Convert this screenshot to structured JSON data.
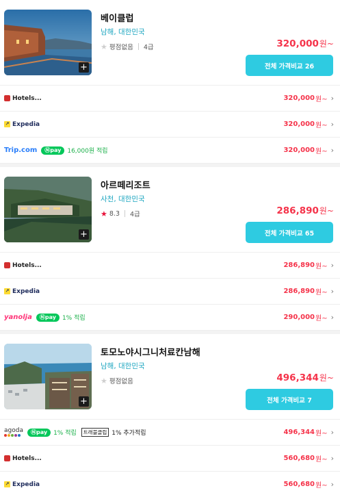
{
  "hotels": [
    {
      "name": "베이클럽",
      "location": "남해, 대한민국",
      "rating_text": "평점없음",
      "grade": "4급",
      "price": "320,000",
      "price_unit": "원~",
      "compare_label": "전체 가격비교 26",
      "offers": [
        {
          "site": "Hotels...",
          "promo": "",
          "extra_badge": "",
          "extra_text": "",
          "price": "320,000",
          "unit": "원~"
        },
        {
          "site": "Expedia",
          "promo": "",
          "extra_badge": "",
          "extra_text": "",
          "price": "320,000",
          "unit": "원~"
        },
        {
          "site": "Trip.com",
          "npay": "pay",
          "promo": "16,000원 적립",
          "extra_badge": "",
          "extra_text": "",
          "price": "320,000",
          "unit": "원~"
        }
      ]
    },
    {
      "name": "아르떼리조트",
      "location": "사천, 대한민국",
      "rating_text": "8.3",
      "grade": "4급",
      "price": "286,890",
      "price_unit": "원~",
      "compare_label": "전체 가격비교 65",
      "offers": [
        {
          "site": "Hotels...",
          "price": "286,890",
          "unit": "원~"
        },
        {
          "site": "Expedia",
          "price": "286,890",
          "unit": "원~"
        },
        {
          "site": "yanolja",
          "npay": "pay",
          "promo": "1% 적립",
          "price": "290,000",
          "unit": "원~"
        }
      ]
    },
    {
      "name": "토모노야시그니처료칸남해",
      "location": "남해, 대한민국",
      "rating_text": "평점없음",
      "grade": "",
      "price": "496,344",
      "price_unit": "원~",
      "compare_label": "전체 가격비교 7",
      "offers": [
        {
          "site": "agoda",
          "npay": "pay",
          "promo": "1% 적립",
          "extra_badge": "트래블클럽",
          "extra_text": "1% 추가적립",
          "price": "496,344",
          "unit": "원~"
        },
        {
          "site": "Hotels...",
          "price": "560,680",
          "unit": "원~"
        },
        {
          "site": "Expedia",
          "price": "560,680",
          "unit": "원~"
        }
      ]
    }
  ],
  "icons": {
    "plus": "+",
    "chevron": "›",
    "star": "★"
  },
  "colors": {
    "accent": "#2ecbe1",
    "price": "#f5334a",
    "location": "#1da6c0",
    "npay": "#03c75a"
  }
}
